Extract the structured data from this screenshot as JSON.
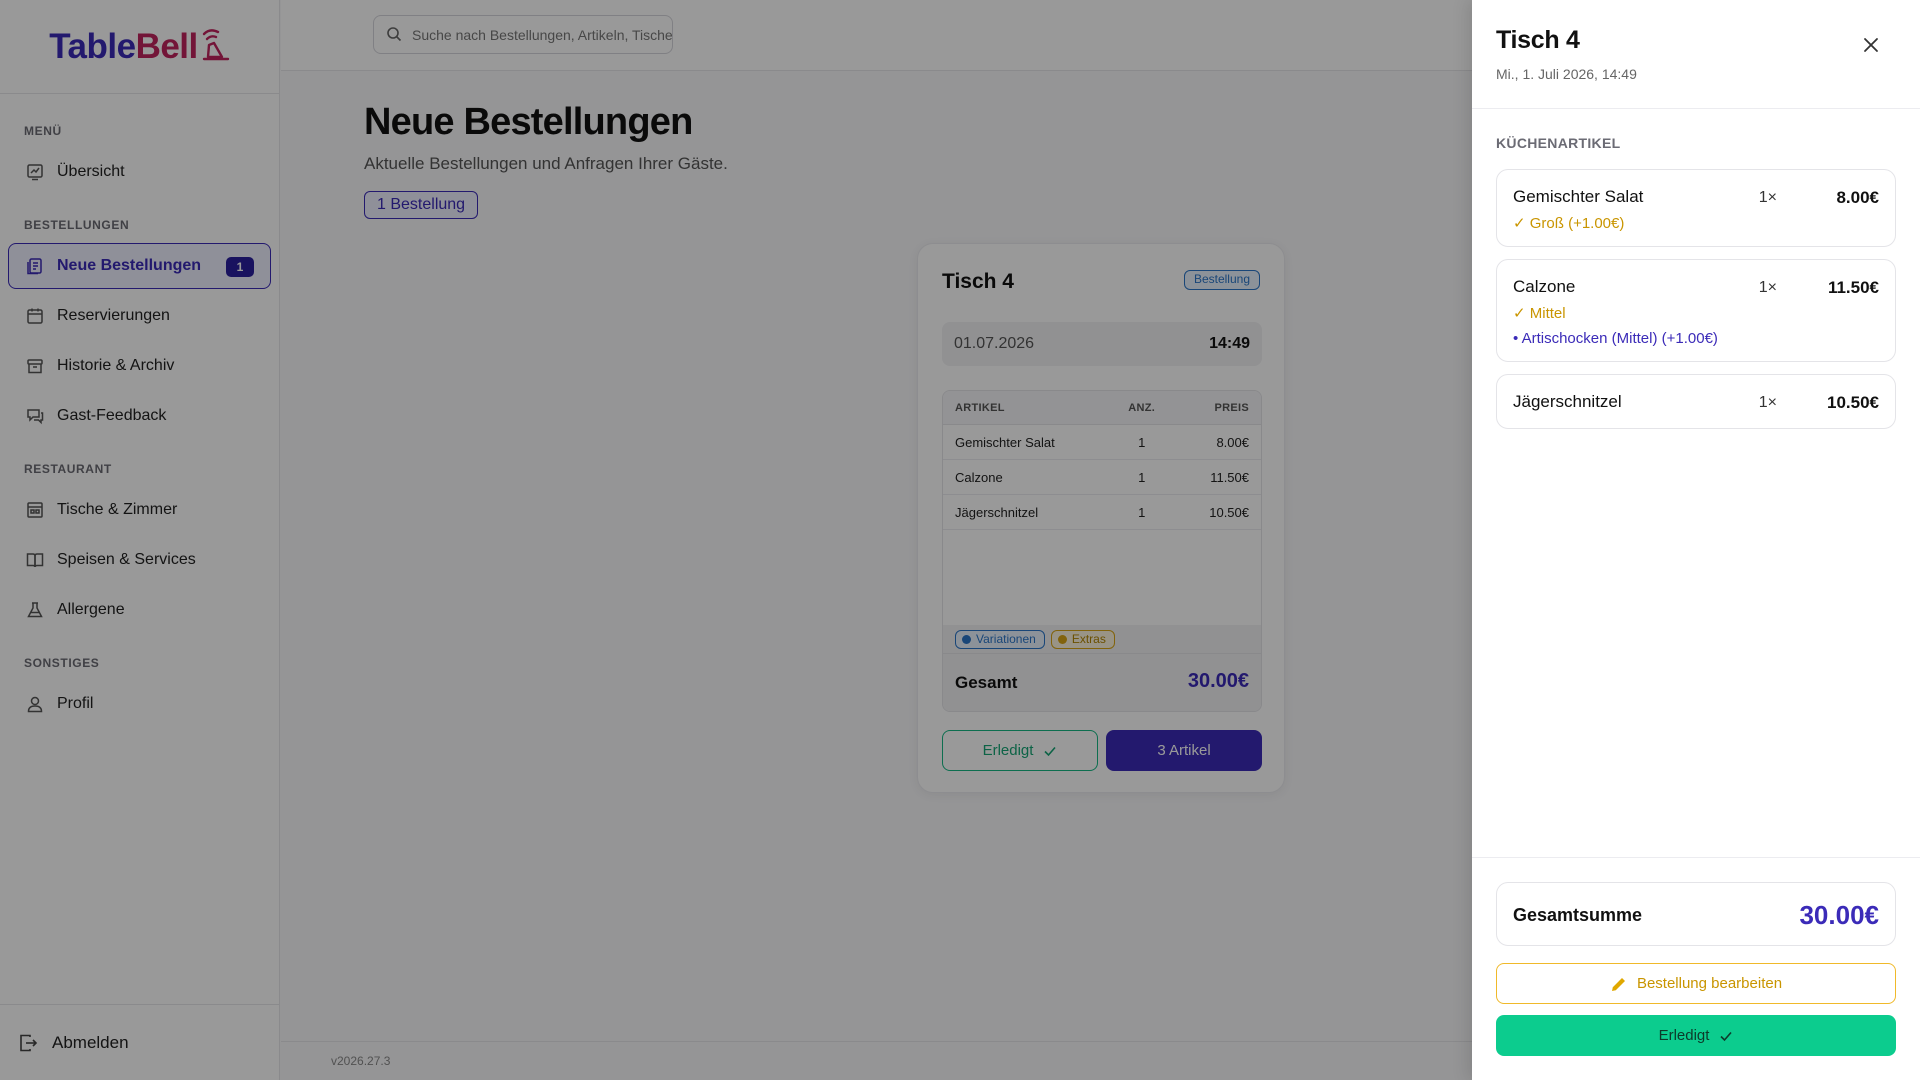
{
  "brand": {
    "part1": "Table",
    "part2": "Bell"
  },
  "search": {
    "placeholder": "Suche nach Bestellungen, Artikeln, Tischen..."
  },
  "sidebar": {
    "sections": [
      {
        "heading": "MENÜ",
        "items": [
          {
            "label": "Übersicht",
            "icon": "dashboard-icon"
          }
        ]
      },
      {
        "heading": "BESTELLUNGEN",
        "items": [
          {
            "label": "Neue Bestellungen",
            "icon": "orders-icon",
            "badge": "1",
            "active": true
          },
          {
            "label": "Reservierungen",
            "icon": "calendar-icon"
          },
          {
            "label": "Historie & Archiv",
            "icon": "archive-icon"
          },
          {
            "label": "Gast-Feedback",
            "icon": "feedback-icon"
          }
        ]
      },
      {
        "heading": "RESTAURANT",
        "items": [
          {
            "label": "Tische & Zimmer",
            "icon": "tables-icon"
          },
          {
            "label": "Speisen & Services",
            "icon": "book-icon"
          },
          {
            "label": "Allergene",
            "icon": "flask-icon"
          }
        ]
      },
      {
        "heading": "SONSTIGES",
        "items": [
          {
            "label": "Profil",
            "icon": "user-icon"
          }
        ]
      }
    ],
    "logout": "Abmelden"
  },
  "main": {
    "title": "Neue Bestellungen",
    "subtitle": "Aktuelle Bestellungen und Anfragen Ihrer Gäste.",
    "count_badge": "1 Bestellung",
    "version": "v2026.27.3"
  },
  "order_card": {
    "title": "Tisch 4",
    "type": "Bestellung",
    "date": "01.07.2026",
    "time": "14:49",
    "columns": {
      "article": "ARTIKEL",
      "qty": "ANZ.",
      "price": "PREIS"
    },
    "rows": [
      {
        "article": "Gemischter Salat",
        "qty": "1",
        "price": "8.00€"
      },
      {
        "article": "Calzone",
        "qty": "1",
        "price": "11.50€"
      },
      {
        "article": "Jägerschnitzel",
        "qty": "1",
        "price": "10.50€"
      }
    ],
    "tags": {
      "variations": "Variationen",
      "extras": "Extras"
    },
    "total_label": "Gesamt",
    "total_value": "30.00€",
    "done_label": "Erledigt",
    "items_label": "3 Artikel"
  },
  "drawer": {
    "title": "Tisch 4",
    "datetime": "Mi., 1. Juli 2026, 14:49",
    "section": "KÜCHENARTIKEL",
    "items": [
      {
        "name": "Gemischter Salat",
        "qty": "1×",
        "price": "8.00€",
        "variation": "✓ Groß (+1.00€)",
        "extra": ""
      },
      {
        "name": "Calzone",
        "qty": "1×",
        "price": "11.50€",
        "variation": "✓ Mittel",
        "extra": "• Artischocken (Mittel) (+1.00€)"
      },
      {
        "name": "Jägerschnitzel",
        "qty": "1×",
        "price": "10.50€",
        "variation": "",
        "extra": ""
      }
    ],
    "sum_label": "Gesamtsumme",
    "sum_value": "30.00€",
    "edit_label": "Bestellung bearbeiten",
    "done_label": "Erledigt"
  },
  "colors": {
    "primary": "#3b2bb8",
    "brand_pink": "#c0245e",
    "success": "#0ccc8e",
    "warning": "#f0b92a",
    "info": "#2a76c9"
  }
}
